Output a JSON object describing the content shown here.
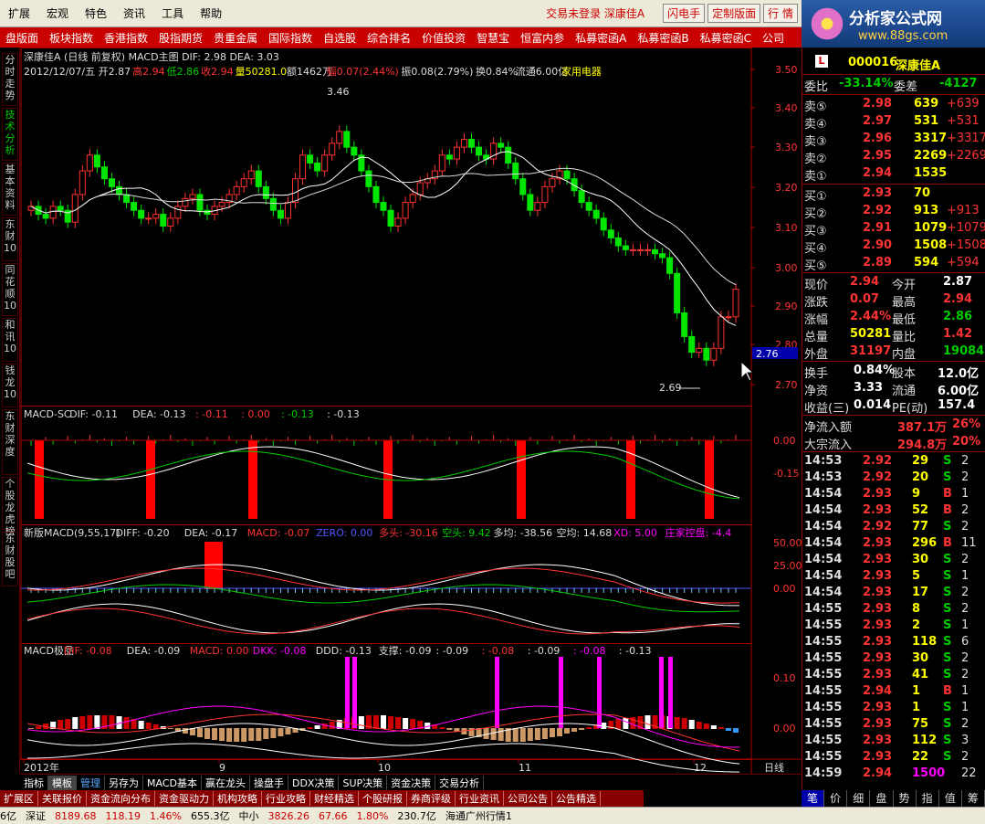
{
  "menu": {
    "items": [
      "扩展",
      "宏观",
      "特色",
      "资讯",
      "工具",
      "帮助"
    ],
    "status_left": "交易未登录",
    "status_right": "深康佳A",
    "buttons": [
      "闪电手",
      "定制版面",
      "行  情"
    ]
  },
  "nav": {
    "items": [
      "盘版面",
      "板块指数",
      "香港指数",
      "股指期货",
      "贵重金属",
      "国际指数",
      "自选股",
      "综合排名",
      "价值投资",
      "智慧宝",
      "恒富内参",
      "私募密函A",
      "私募密函B",
      "私募密函C",
      "公司"
    ]
  },
  "logo": {
    "title": "分析家公式网",
    "url": "www.88gs.com"
  },
  "left_tabs": [
    "分时走势",
    "技术分析",
    "基本资料",
    "东财10",
    "同花顺10",
    "和讯10",
    "钱龙10",
    "东财深度",
    "个股龙虎榜",
    "东财股吧"
  ],
  "chart": {
    "header1": "深康佳A (日线 前复权) MACD主图  DIF: 2.98  DEA: 3.03",
    "header2_parts": [
      {
        "t": "2012/12/07/五",
        "c": "#ddd"
      },
      {
        "t": "开2.87",
        "c": "#ddd"
      },
      {
        "t": "高2.94",
        "c": "#f33"
      },
      {
        "t": "低2.86",
        "c": "#0c0"
      },
      {
        "t": "收2.94",
        "c": "#f33"
      },
      {
        "t": "量50281.0",
        "c": "#ff0"
      },
      {
        "t": "额1462万",
        "c": "#ddd"
      },
      {
        "t": "幅0.07(2.44%)",
        "c": "#f33"
      },
      {
        "t": "振0.08(2.79%)",
        "c": "#ddd"
      },
      {
        "t": "换0.84%",
        "c": "#ddd"
      },
      {
        "t": "流通6.00亿",
        "c": "#ddd"
      },
      {
        "t": "家用电器",
        "c": "#ff0"
      }
    ],
    "y_axis_price": [
      "3.50",
      "3.40",
      "3.30",
      "3.20",
      "3.10",
      "3.00",
      "2.90",
      "2.80",
      "2.70"
    ],
    "price_high_label": "3.46",
    "price_low_label": "2.69",
    "current_price_tag": "2.76",
    "macd_sc": {
      "header_parts": [
        {
          "t": "MACD-SC",
          "c": "#ddd"
        },
        {
          "t": "DIF: -0.11",
          "c": "#ddd"
        },
        {
          "t": "DEA: -0.13",
          "c": "#ddd"
        },
        {
          "t": ": -0.11",
          "c": "#f33"
        },
        {
          "t": ": 0.00",
          "c": "#f33"
        },
        {
          "t": ": -0.13",
          "c": "#0c0"
        },
        {
          "t": ": -0.13",
          "c": "#ddd"
        }
      ],
      "y_axis": [
        "0.00",
        "-0.15"
      ]
    },
    "new_macd": {
      "header_parts": [
        {
          "t": "新版MACD(9,55,17)",
          "c": "#ddd"
        },
        {
          "t": "DIFF: -0.20",
          "c": "#ddd"
        },
        {
          "t": "DEA: -0.17",
          "c": "#ddd"
        },
        {
          "t": "MACD: -0.07",
          "c": "#f33"
        },
        {
          "t": "ZERO: 0.00",
          "c": "#55f"
        },
        {
          "t": "多头: -30.16",
          "c": "#f33"
        },
        {
          "t": "空头: 9.42",
          "c": "#0c0"
        },
        {
          "t": "多均: -38.56",
          "c": "#ddd"
        },
        {
          "t": "空均: 14.68",
          "c": "#ddd"
        },
        {
          "t": "XD: 5.00",
          "c": "#f0f"
        },
        {
          "t": "庄家控盘: -4.4",
          "c": "#f0f"
        }
      ],
      "y_axis": [
        "50.00",
        "25.00",
        "0.00"
      ]
    },
    "macd_jp": {
      "header_parts": [
        {
          "t": "MACD极品",
          "c": "#ddd"
        },
        {
          "t": "DIF: -0.08",
          "c": "#f33"
        },
        {
          "t": "DEA: -0.09",
          "c": "#ddd"
        },
        {
          "t": "MACD: 0.00",
          "c": "#f33"
        },
        {
          "t": "DKK: -0.08",
          "c": "#f0f"
        },
        {
          "t": "DDD: -0.13",
          "c": "#ddd"
        },
        {
          "t": "支撑: -0.09",
          "c": "#ddd"
        },
        {
          "t": ": -0.09",
          "c": "#ddd"
        },
        {
          "t": ": -0.08",
          "c": "#f33"
        },
        {
          "t": ": -0.09",
          "c": "#ddd"
        },
        {
          "t": ": -0.08",
          "c": "#f0f"
        },
        {
          "t": ": -0.13",
          "c": "#ddd"
        }
      ],
      "y_axis": [
        "0.10",
        "0.00"
      ]
    },
    "x_labels": [
      "2012年",
      "9",
      "10",
      "11",
      "12"
    ],
    "period_label": "日线"
  },
  "quote": {
    "code": "000016",
    "name": "深康佳A",
    "ratio": {
      "l1": "委比",
      "v1": "-33.14%",
      "l2": "委差",
      "v2": "-4127"
    },
    "asks": [
      {
        "l": "卖⑤",
        "p": "2.98",
        "v": "639",
        "d": "+639"
      },
      {
        "l": "卖④",
        "p": "2.97",
        "v": "531",
        "d": "+531"
      },
      {
        "l": "卖③",
        "p": "2.96",
        "v": "3317",
        "d": "+3317"
      },
      {
        "l": "卖②",
        "p": "2.95",
        "v": "2269",
        "d": "+2269"
      },
      {
        "l": "卖①",
        "p": "2.94",
        "v": "1535",
        "d": ""
      }
    ],
    "bids": [
      {
        "l": "买①",
        "p": "2.93",
        "v": "70",
        "d": ""
      },
      {
        "l": "买②",
        "p": "2.92",
        "v": "913",
        "d": "+913"
      },
      {
        "l": "买③",
        "p": "2.91",
        "v": "1079",
        "d": "+1079"
      },
      {
        "l": "买④",
        "p": "2.90",
        "v": "1508",
        "d": "+1508"
      },
      {
        "l": "买⑤",
        "p": "2.89",
        "v": "594",
        "d": "+594"
      }
    ],
    "stats": [
      {
        "l1": "现价",
        "v1": "2.94",
        "c1": "#f33",
        "l2": "今开",
        "v2": "2.87",
        "c2": "#fff"
      },
      {
        "l1": "涨跌",
        "v1": "0.07",
        "c1": "#f33",
        "l2": "最高",
        "v2": "2.94",
        "c2": "#f33"
      },
      {
        "l1": "涨幅",
        "v1": "2.44%",
        "c1": "#f33",
        "l2": "最低",
        "v2": "2.86",
        "c2": "#0c0"
      },
      {
        "l1": "总量",
        "v1": "50281",
        "c1": "#ff0",
        "l2": "量比",
        "v2": "1.42",
        "c2": "#f33"
      },
      {
        "l1": "外盘",
        "v1": "31197",
        "c1": "#f33",
        "l2": "内盘",
        "v2": "19084",
        "c2": "#0c0"
      }
    ],
    "stats2": [
      {
        "l1": "换手",
        "v1": "0.84%",
        "l2": "股本",
        "v2": "12.0亿"
      },
      {
        "l1": "净资",
        "v1": "3.33",
        "l2": "流通",
        "v2": "6.00亿"
      },
      {
        "l1": "收益(三)",
        "v1": "0.014",
        "l2": "PE(动)",
        "v2": "157.4"
      }
    ],
    "flows": [
      {
        "l": "净流入额",
        "v": "387.1万",
        "p": "26%"
      },
      {
        "l": "大宗流入",
        "v": "294.8万",
        "p": "20%"
      }
    ],
    "ticks": [
      {
        "t": "14:53",
        "p": "2.92",
        "v": "29",
        "s": "S",
        "n": "2"
      },
      {
        "t": "14:53",
        "p": "2.92",
        "v": "20",
        "s": "S",
        "n": "2"
      },
      {
        "t": "14:54",
        "p": "2.93",
        "v": "9",
        "s": "B",
        "n": "1"
      },
      {
        "t": "14:54",
        "p": "2.93",
        "v": "52",
        "s": "B",
        "n": "2"
      },
      {
        "t": "14:54",
        "p": "2.92",
        "v": "77",
        "s": "S",
        "n": "2"
      },
      {
        "t": "14:54",
        "p": "2.93",
        "v": "296",
        "s": "B",
        "n": "11"
      },
      {
        "t": "14:54",
        "p": "2.93",
        "v": "30",
        "s": "S",
        "n": "2"
      },
      {
        "t": "14:54",
        "p": "2.93",
        "v": "5",
        "s": "S",
        "n": "1"
      },
      {
        "t": "14:54",
        "p": "2.93",
        "v": "17",
        "s": "S",
        "n": "2"
      },
      {
        "t": "14:55",
        "p": "2.93",
        "v": "8",
        "s": "S",
        "n": "2"
      },
      {
        "t": "14:55",
        "p": "2.93",
        "v": "2",
        "s": "S",
        "n": "1"
      },
      {
        "t": "14:55",
        "p": "2.93",
        "v": "118",
        "s": "S",
        "n": "6"
      },
      {
        "t": "14:55",
        "p": "2.93",
        "v": "30",
        "s": "S",
        "n": "2"
      },
      {
        "t": "14:55",
        "p": "2.93",
        "v": "41",
        "s": "S",
        "n": "2"
      },
      {
        "t": "14:55",
        "p": "2.94",
        "v": "1",
        "s": "B",
        "n": "1"
      },
      {
        "t": "14:55",
        "p": "2.93",
        "v": "1",
        "s": "S",
        "n": "1"
      },
      {
        "t": "14:55",
        "p": "2.93",
        "v": "75",
        "s": "S",
        "n": "2"
      },
      {
        "t": "14:55",
        "p": "2.93",
        "v": "112",
        "s": "S",
        "n": "3"
      },
      {
        "t": "14:55",
        "p": "2.93",
        "v": "22",
        "s": "S",
        "n": "2"
      },
      {
        "t": "14:59",
        "p": "2.94",
        "v": "1500",
        "s": "",
        "n": "22"
      }
    ],
    "tabs": [
      "笔",
      "价",
      "细",
      "盘",
      "势",
      "指",
      "值",
      "筹"
    ]
  },
  "bottom1": [
    "指标",
    "模板",
    "管理",
    "另存为",
    "MACD基本",
    "赢在龙头",
    "操盘手",
    "DDX决策",
    "SUP决策",
    "资金决策",
    "交易分析"
  ],
  "bottom2": [
    "扩展区",
    "关联报价",
    "资金流向分布",
    "资金驱动力",
    "机构攻略",
    "行业攻略",
    "财经精选",
    "个股研报",
    "券商评级",
    "行业资讯",
    "公司公告",
    "公告精选"
  ],
  "statusbar": [
    {
      "t": "6亿",
      "c": "#000"
    },
    {
      "t": "深证",
      "c": "#000"
    },
    {
      "t": "8189.68",
      "c": "#c00"
    },
    {
      "t": "118.19",
      "c": "#c00"
    },
    {
      "t": "1.46%",
      "c": "#c00"
    },
    {
      "t": "655.3亿",
      "c": "#000"
    },
    {
      "t": "中小",
      "c": "#000"
    },
    {
      "t": "3826.26",
      "c": "#c00"
    },
    {
      "t": "67.66",
      "c": "#c00"
    },
    {
      "t": "1.80%",
      "c": "#c00"
    },
    {
      "t": "230.7亿",
      "c": "#000"
    },
    {
      "t": "海通广州行情1",
      "c": "#000"
    }
  ],
  "colors": {
    "up": "#ff3232",
    "down": "#00e600",
    "bg": "#000000",
    "grid": "#800000"
  }
}
